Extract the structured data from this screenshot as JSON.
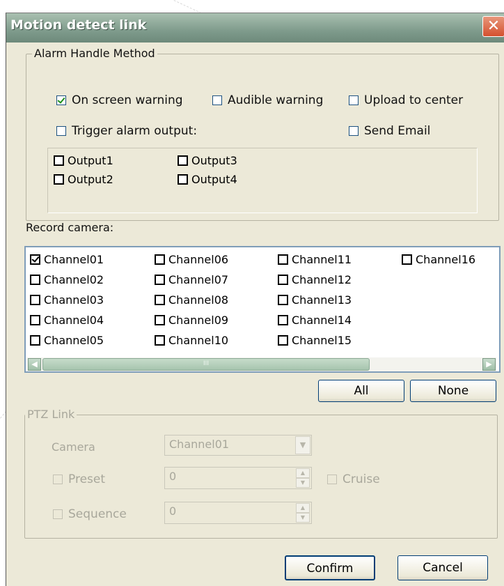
{
  "window": {
    "title": "Motion detect link",
    "close_icon": "close-icon"
  },
  "alarm": {
    "legend": "Alarm Handle Method",
    "on_screen": {
      "label": "On screen warning",
      "checked": true
    },
    "audible": {
      "label": "Audible warning",
      "checked": false
    },
    "upload": {
      "label": "Upload to center",
      "checked": false
    },
    "trigger": {
      "label": "Trigger alarm output:",
      "checked": false
    },
    "email": {
      "label": "Send Email",
      "checked": false
    },
    "outputs": [
      {
        "label": "Output1",
        "checked": false
      },
      {
        "label": "Output2",
        "checked": false
      },
      {
        "label": "Output3",
        "checked": false
      },
      {
        "label": "Output4",
        "checked": false
      }
    ]
  },
  "record": {
    "label": "Record camera:",
    "channels": [
      {
        "label": "Channel01",
        "checked": true
      },
      {
        "label": "Channel02",
        "checked": false
      },
      {
        "label": "Channel03",
        "checked": false
      },
      {
        "label": "Channel04",
        "checked": false
      },
      {
        "label": "Channel05",
        "checked": false
      },
      {
        "label": "Channel06",
        "checked": false
      },
      {
        "label": "Channel07",
        "checked": false
      },
      {
        "label": "Channel08",
        "checked": false
      },
      {
        "label": "Channel09",
        "checked": false
      },
      {
        "label": "Channel10",
        "checked": false
      },
      {
        "label": "Channel11",
        "checked": false
      },
      {
        "label": "Channel12",
        "checked": false
      },
      {
        "label": "Channel13",
        "checked": false
      },
      {
        "label": "Channel14",
        "checked": false
      },
      {
        "label": "Channel15",
        "checked": false
      },
      {
        "label": "Channel16",
        "checked": false
      }
    ],
    "all_button": "All",
    "none_button": "None"
  },
  "ptz": {
    "legend": "PTZ Link",
    "camera_label": "Camera",
    "camera_value": "Channel01",
    "preset_label": "Preset",
    "preset_value": "0",
    "cruise_label": "Cruise",
    "sequence_label": "Sequence",
    "sequence_value": "0"
  },
  "buttons": {
    "confirm": "Confirm",
    "cancel": "Cancel"
  }
}
